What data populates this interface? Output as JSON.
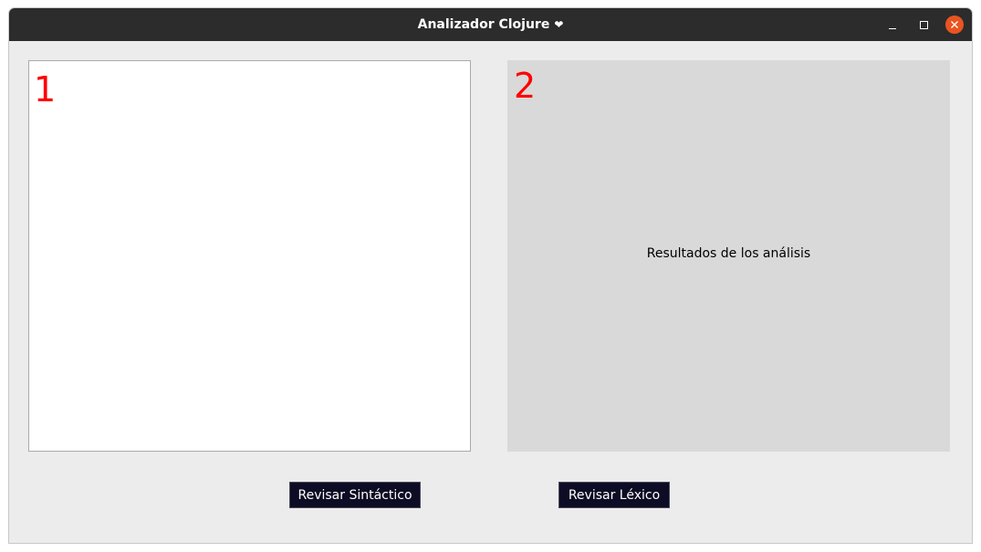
{
  "window": {
    "title": "Analizador Clojure",
    "title_suffix": "❤"
  },
  "editor": {
    "label_number": "1",
    "content": ""
  },
  "results": {
    "label_number": "2",
    "text": "Resultados de los análisis"
  },
  "buttons": {
    "syntax_label": "Revisar Sintáctico",
    "lexical_label": "Revisar Léxico"
  },
  "colors": {
    "titlebar": "#2c2c2c",
    "window_bg": "#ececec",
    "results_bg": "#d9d9d9",
    "panel_number": "#ff0000",
    "button_bg": "#0c0c24",
    "close_button": "#e95420"
  },
  "icons": {
    "minimize": "minimize-icon",
    "maximize": "maximize-icon",
    "close": "close-icon",
    "title_heart": "heart-icon"
  }
}
